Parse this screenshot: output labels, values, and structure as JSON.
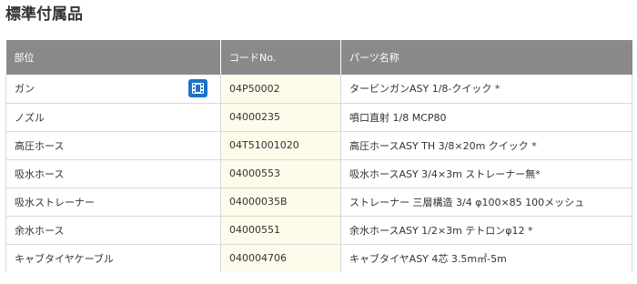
{
  "section": {
    "title": "標準付属品"
  },
  "table": {
    "headers": {
      "part": "部位",
      "code": "コードNo.",
      "name": "パーツ名称"
    },
    "rows": [
      {
        "part": "ガン",
        "code": "04P50002",
        "name": "タービンガンASY 1/8-クイック *",
        "video_icon": "film-icon"
      },
      {
        "part": "ノズル",
        "code": "04000235",
        "name": "噴口直射 1/8 MCP80"
      },
      {
        "part": "高圧ホース",
        "code": "04T51001020",
        "name": "高圧ホースASY TH 3/8×20m クイック *"
      },
      {
        "part": "吸水ホース",
        "code": "04000553",
        "name": "吸水ホースASY 3/4×3m ストレーナー無*"
      },
      {
        "part": "吸水ストレーナー",
        "code": "04000035B",
        "name": "ストレーナー 三層構造 3/4 φ100×85 100メッシュ"
      },
      {
        "part": "余水ホース",
        "code": "04000551",
        "name": "余水ホースASY 1/2×3m テトロンφ12 *"
      },
      {
        "part": "キャブタイヤケーブル",
        "code": "040004706",
        "name": "キャブタイヤASY 4芯 3.5m㎡-5m"
      }
    ]
  },
  "colors": {
    "header_bg": "#8a8a8a",
    "code_bg": "#fdfbe9",
    "icon_blue": "#1a73c7"
  }
}
